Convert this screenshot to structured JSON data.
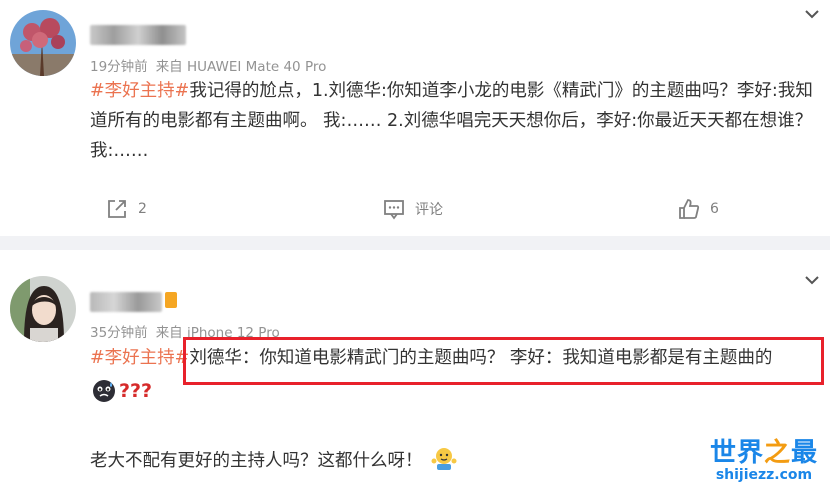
{
  "post1": {
    "meta_time": "19分钟前",
    "meta_source": "来自 HUAWEI Mate 40 Pro",
    "hashtag": "#李好主持#",
    "text": "我记得的尬点，1.刘德华:你知道李小龙的电影《精武门》的主题曲吗？李好:我知道所有的电影都有主题曲啊。 我:…… 2.刘德华唱完天天想你后，李好:你最近天天都在想谁？ 我:……",
    "repost_count": "2",
    "comment_label": "评论",
    "like_count": "6"
  },
  "post2": {
    "meta_time": "35分钟前",
    "meta_source": "来自 iPhone 12 Pro",
    "hashtag": "#李好主持#",
    "text": "刘德华：你知道电影精武门的主题曲吗？ 李好：我知道电影都是有主题曲的",
    "question_marks": "???",
    "comment": "老大不配有更好的主持人吗？这都什么呀！"
  },
  "watermark": {
    "title_part1": "世界",
    "title_part2": "之",
    "title_part3": "最",
    "url": "shijiezz.com"
  },
  "colors": {
    "hashtag": "#eb7350",
    "highlight_box": "#e8212b",
    "separator": "#f1f2f5",
    "watermark_blue": "#1a86e8",
    "watermark_orange": "#f39c12"
  },
  "icons": [
    "chevron-down-icon",
    "repost-icon",
    "comment-icon",
    "like-icon",
    "sweat-emoji-icon",
    "shrug-emoji-icon"
  ]
}
